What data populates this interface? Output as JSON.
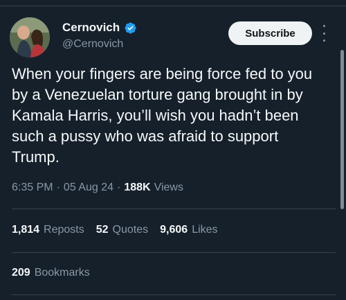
{
  "author": {
    "name": "Cernovich",
    "handle": "@Cernovich",
    "verified": true
  },
  "actions": {
    "subscribe_label": "Subscribe",
    "more_icon": "more-vertical-icon"
  },
  "tweet": {
    "text": "When your fingers are being force fed to you\nby a Venezuelan torture gang brought in by\nKamala Harris, you’ll wish you hadn’t been\nsuch a pussy who was afraid to support\nTrump."
  },
  "meta": {
    "time": "6:35 PM",
    "separator": "·",
    "date": "05 Aug 24",
    "views_count": "188K",
    "views_label": "Views"
  },
  "stats": {
    "reposts_count": "1,814",
    "reposts_label": "Reposts",
    "quotes_count": "52",
    "quotes_label": "Quotes",
    "likes_count": "9,606",
    "likes_label": "Likes",
    "bookmarks_count": "209",
    "bookmarks_label": "Bookmarks"
  },
  "colors": {
    "background": "#15202b",
    "text_primary": "#f7f9f9",
    "text_secondary": "#8b98a5",
    "verified_blue": "#1d9bf0",
    "divider": "#38444d"
  }
}
